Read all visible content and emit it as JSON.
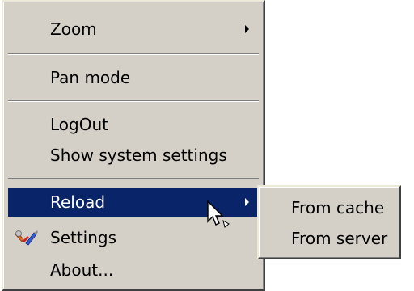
{
  "context_menu": {
    "items": {
      "zoom": "Zoom",
      "pan_mode": "Pan mode",
      "logout": "LogOut",
      "show_system_settings": "Show system settings",
      "reload": "Reload",
      "settings": "Settings",
      "about": "About..."
    },
    "highlighted_item": "Reload",
    "icons": {
      "settings": "settings-tools-icon",
      "submenu": "submenu-arrow-icon"
    }
  },
  "reload_submenu": {
    "items": [
      "From cache",
      "From server"
    ]
  },
  "colors": {
    "menu_background": "#d4d0c8",
    "highlight_background": "#0a246a",
    "highlight_text": "#ffffff"
  }
}
